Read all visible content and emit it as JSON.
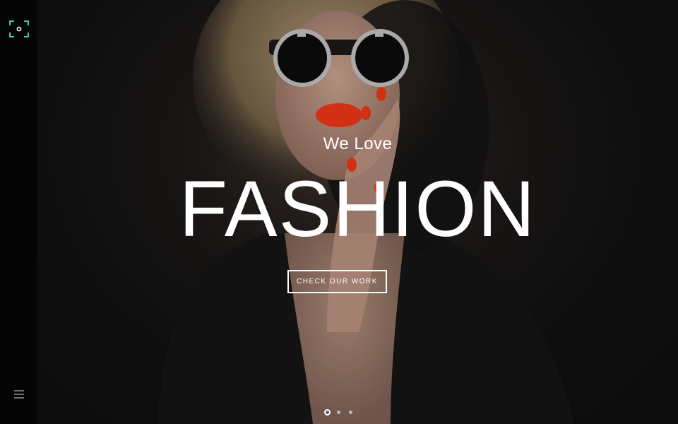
{
  "brand": {
    "logo_icon": "camera-focus-icon",
    "accent": "#3fd0a8"
  },
  "nav": {
    "menu_icon": "hamburger-menu-icon"
  },
  "hero": {
    "subtitle": "We Love",
    "title": "FASHION",
    "cta_label": "CHECK OUR WORK"
  },
  "slider": {
    "slide_count": 3,
    "active_slide": 1
  }
}
